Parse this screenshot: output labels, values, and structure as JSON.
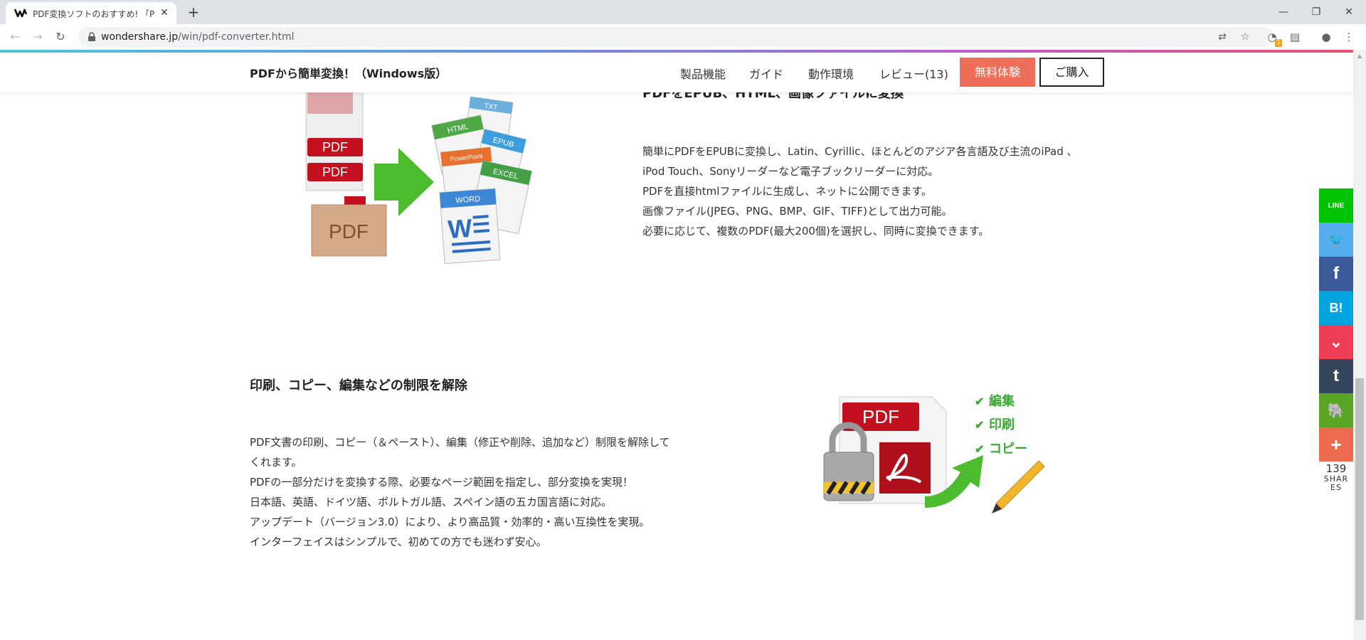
{
  "browser": {
    "tab_title": "PDF変換ソフトのおすすめ! 「P",
    "url_host": "wondershare.jp",
    "url_path": "/win/pdf-converter.html",
    "extension_badge": "1"
  },
  "header": {
    "title": "PDFから簡単変換！（Windows版）",
    "nav": [
      "製品機能",
      "ガイド",
      "動作環境",
      "レビュー(13)"
    ],
    "trial_label": "無料体験",
    "buy_label": "ご購入"
  },
  "section1": {
    "heading_partial": "PDFをEPUB、HTML、画像ファイルに変換",
    "lines": [
      "簡単にPDFをEPUBに変換し、Latin、Cyrillic、ほとんどのアジア各言語及び主流のiPad 、",
      "iPod Touch、Sonyリーダーなど電子ブックリーダーに対応。",
      "PDFを直接htmlファイルに生成し、ネットに公開できます。",
      "画像ファイル(JPEG、PNG、BMP、GIF、TIFF)として出力可能。",
      "必要に応じて、複数のPDF(最大200個)を選択し、同時に変換できます。"
    ],
    "illustration": {
      "pdf_label": "PDF",
      "formats": [
        "TXT",
        "HTML",
        "EPUB",
        "PowerPoint",
        "EXCEL",
        "WORD"
      ]
    }
  },
  "section2": {
    "heading": "印刷、コピー、編集などの制限を解除",
    "lines": [
      "PDF文書の印刷、コピー（＆ペースト）、編集（修正や削除、追加など）制限を解除して",
      "くれます。",
      "PDFの一部分だけを変換する際、必要なページ範囲を指定し、部分変換を実現！",
      "日本語、英語、ドイツ語、ポルトガル語、スペイン語の五カ国言語に対応。",
      "アップデート（バージョン3.0）により、より高品質・効率的・高い互換性を実現。",
      "インターフェイスはシンプルで、初めての方でも迷わず安心。"
    ],
    "illustration": {
      "pdf_label": "PDF",
      "checks": [
        "編集",
        "印刷",
        "コピー"
      ]
    }
  },
  "share": {
    "count": "139",
    "label": "SHARES",
    "buttons": [
      {
        "name": "line",
        "glyph": "LINE",
        "color": "#00c300"
      },
      {
        "name": "twitter",
        "glyph": "🐦",
        "color": "#55acee"
      },
      {
        "name": "facebook",
        "glyph": "f",
        "color": "#3b5998"
      },
      {
        "name": "hatena",
        "glyph": "B!",
        "color": "#00a4de"
      },
      {
        "name": "pocket",
        "glyph": "⌄",
        "color": "#ef3f56"
      },
      {
        "name": "tumblr",
        "glyph": "t",
        "color": "#35465c"
      },
      {
        "name": "evernote",
        "glyph": "🐘",
        "color": "#5ba525"
      },
      {
        "name": "more",
        "glyph": "+",
        "color": "#ec6b4f"
      }
    ]
  }
}
